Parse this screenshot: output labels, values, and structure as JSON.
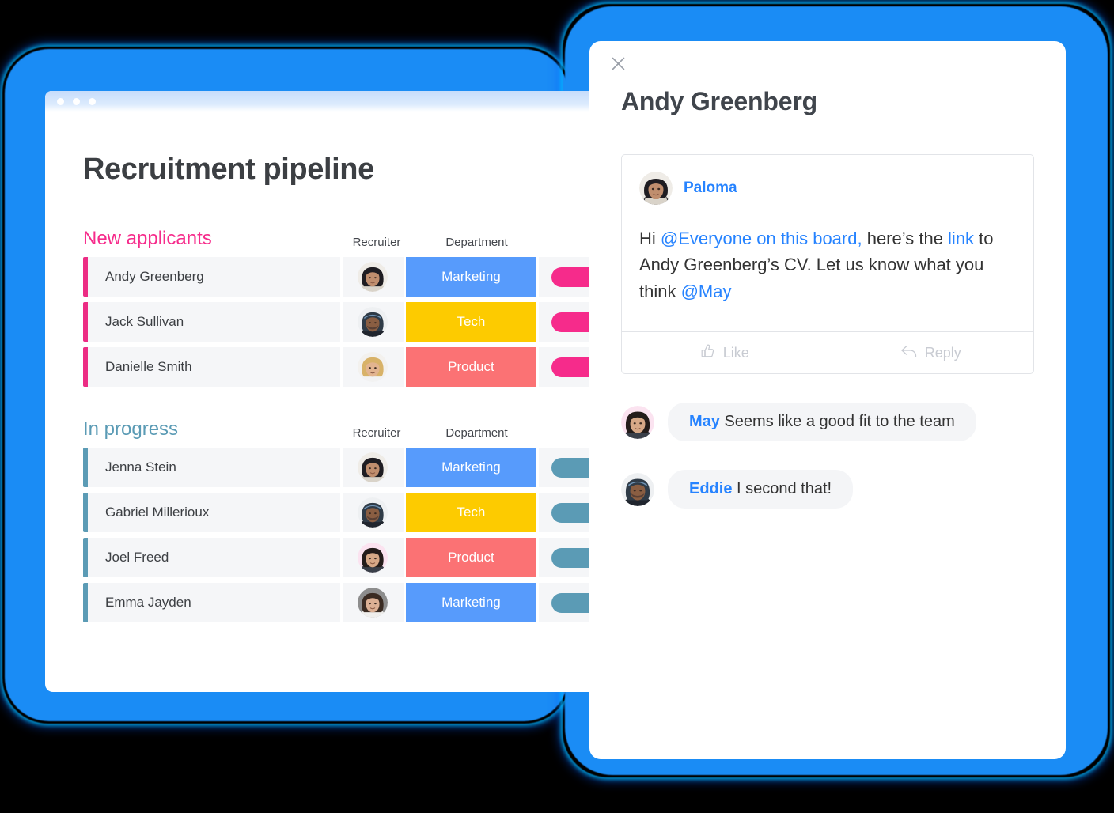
{
  "window": {
    "traffic_lights": [
      "close-dot",
      "minimize-dot",
      "maximize-dot"
    ],
    "page_title": "Recruitment pipeline"
  },
  "colors": {
    "accent_blue": "#1a8cf5",
    "pink": "#f62b8b",
    "teal": "#5b9bb5",
    "marketing": "#579bfc",
    "tech": "#fdcb00",
    "product": "#fb7274",
    "link_blue": "#2683ff",
    "row_bg": "#f5f6f8"
  },
  "columns": {
    "recruiter": "Recruiter",
    "department": "Department"
  },
  "groups": [
    {
      "title": "New applicants",
      "color": "#f62b8b",
      "accent": "pink",
      "rows": [
        {
          "name": "Andy Greenberg",
          "department": "Marketing",
          "dept_class": "dept-marketing",
          "recruiter_avatar": "paloma"
        },
        {
          "name": "Jack Sullivan",
          "department": "Tech",
          "dept_class": "dept-tech",
          "recruiter_avatar": "eddie"
        },
        {
          "name": "Danielle Smith",
          "department": "Product",
          "dept_class": "dept-product",
          "recruiter_avatar": "blonde"
        }
      ]
    },
    {
      "title": "In progress",
      "color": "#5b9bb5",
      "accent": "teal",
      "rows": [
        {
          "name": "Jenna Stein",
          "department": "Marketing",
          "dept_class": "dept-marketing",
          "recruiter_avatar": "paloma"
        },
        {
          "name": "Gabriel Millerioux",
          "department": "Tech",
          "dept_class": "dept-tech",
          "recruiter_avatar": "eddie"
        },
        {
          "name": "Joel Freed",
          "department": "Product",
          "dept_class": "dept-product",
          "recruiter_avatar": "may"
        },
        {
          "name": "Emma Jayden",
          "department": "Marketing",
          "dept_class": "dept-marketing",
          "recruiter_avatar": "emma"
        }
      ]
    }
  ],
  "modal": {
    "close_icon": "close-icon",
    "title": "Andy Greenberg",
    "comment": {
      "author": "Paloma",
      "avatar": "paloma",
      "text_part_1": "Hi ",
      "mention_everyone": "@Everyone on this board,",
      "text_part_2": " here’s the ",
      "link": "link",
      "text_part_3": " to Andy Greenberg’s CV. Let us know what you think ",
      "mention_may": "@May"
    },
    "actions": {
      "like": "Like",
      "like_icon": "thumbs-up-icon",
      "reply": "Reply",
      "reply_icon": "reply-arrow-icon"
    },
    "replies": [
      {
        "author": "May",
        "avatar": "may",
        "text": " Seems like a good fit to the team"
      },
      {
        "author": "Eddie",
        "avatar": "eddie",
        "text": " I second that!"
      }
    ]
  }
}
